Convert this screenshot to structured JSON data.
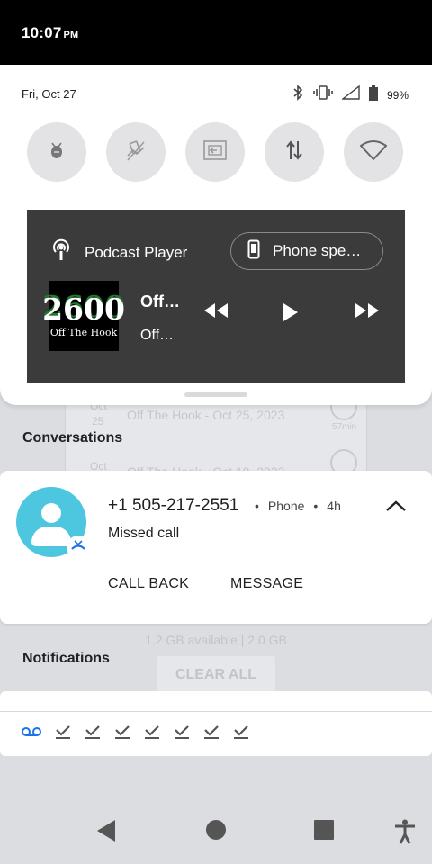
{
  "status_bar": {
    "time": "10:07",
    "ampm": "PM"
  },
  "quick_settings": {
    "date": "Fri, Oct 27",
    "battery_percent": "99%",
    "status_icons": [
      "bluetooth-icon",
      "vibrate-icon",
      "signal-icon",
      "battery-icon"
    ],
    "tiles": [
      {
        "icon": "bug-icon",
        "active": false
      },
      {
        "icon": "auto-rotate-icon",
        "active": false
      },
      {
        "icon": "screen-cast-icon",
        "active": false
      },
      {
        "icon": "data-transfer-icon",
        "active": false
      },
      {
        "icon": "wifi-icon",
        "active": false
      }
    ]
  },
  "media_player": {
    "app_name": "Podcast Player",
    "output_label": "Phone spe…",
    "art_big": "2600",
    "art_small": "Off The Hook",
    "title": "Off…",
    "subtitle": "Off…",
    "controls": [
      "rewind-icon",
      "play-icon",
      "fast-forward-icon"
    ]
  },
  "background": {
    "date_ghost_1a": "Oct",
    "date_ghost_1b": "25",
    "episode_ghost_1": "Off The Hook - Oct 25, 2023",
    "duration_ghost": "57min",
    "date_ghost_2": "Oct",
    "episode_ghost_2": "Off The Hook - Oct 18, 2023",
    "storage": "1.2 GB available | 2.0 GB",
    "clear_all": "CLEAR ALL"
  },
  "conversations": {
    "header": "Conversations",
    "card": {
      "caller": "+1 505-217-2551",
      "app": "Phone",
      "age": "4h",
      "message": "Missed call",
      "actions": [
        "CALL BACK",
        "MESSAGE"
      ]
    }
  },
  "notifications": {
    "header": "Notifications",
    "icons": [
      "voicemail-icon",
      "check-icon",
      "check-icon",
      "check-icon",
      "check-icon",
      "check-icon",
      "check-icon",
      "check-icon"
    ]
  },
  "colors": {
    "accent_blue": "#1a73e8",
    "avatar": "#4dc6df",
    "media_bg": "#3b3b3b"
  }
}
